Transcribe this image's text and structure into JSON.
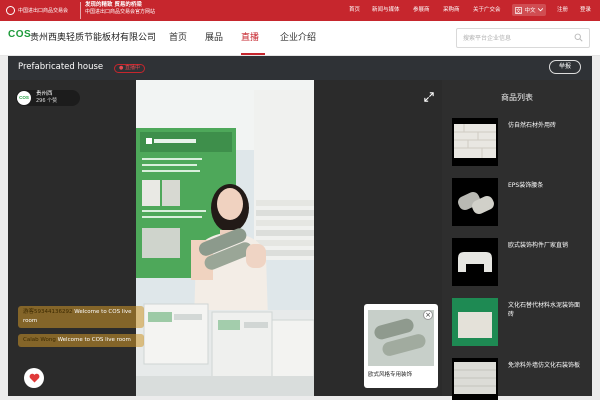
{
  "topbar": {
    "logo_text": "中国进出口商品交易会",
    "slogan_line1": "发现的精致 贸易的桥梁",
    "slogan_line2": "中国进出口商品交易会官方网站",
    "nav": [
      "首页",
      "新闻与媒体",
      "参展商",
      "采购商",
      "关于广交会"
    ],
    "language": "中文",
    "register": "注册",
    "login": "登录"
  },
  "header": {
    "brand": "COS",
    "company_name": "贵州西奥轻质节能板材有限公司",
    "nav": [
      "首页",
      "展品",
      "直播",
      "企业介绍"
    ],
    "search_placeholder": "搜索平台企业信息"
  },
  "live": {
    "title": "Prefabricated house",
    "badge": "● 直播中",
    "report": "举报",
    "host_avatar": "COS",
    "host_name": "贵州西",
    "host_fans": "296 个赞",
    "chat": [
      {
        "user": "游客59344136292",
        "text": "Welcome to COS live room"
      },
      {
        "user": "Calab Wong",
        "text": "Welcome to COS live room"
      }
    ],
    "popup_product": "欧式风格专用装饰"
  },
  "products": {
    "title": "商品列表",
    "items": [
      {
        "name": "仿自然石材外用砖"
      },
      {
        "name": "EPS装饰腰条"
      },
      {
        "name": "欧式装饰构件厂家直销"
      },
      {
        "name": "文化石替代材料水泥装饰面砖"
      },
      {
        "name": "免涂料外墙仿文化石装饰板"
      }
    ]
  },
  "colors": {
    "brand_red": "#c6262d",
    "brand_green": "#1d9a3a",
    "panel": "#2b2b2b"
  }
}
